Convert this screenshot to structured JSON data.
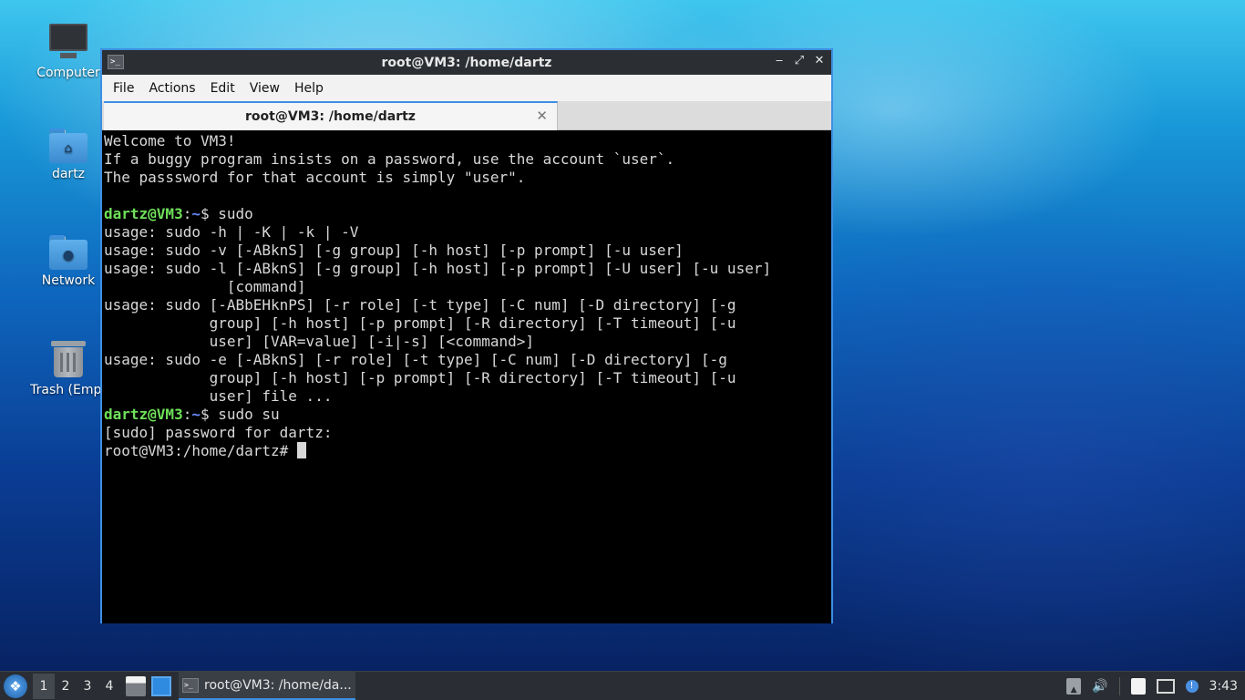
{
  "desktop": {
    "icons": [
      {
        "label": "Computer",
        "icon": "computer-icon"
      },
      {
        "label": "dartz",
        "icon": "home-folder-icon"
      },
      {
        "label": "Network",
        "icon": "network-folder-icon"
      },
      {
        "label": "Trash (Empt",
        "icon": "trash-icon"
      }
    ]
  },
  "window": {
    "title": "root@VM3: /home/dartz",
    "menu": [
      "File",
      "Actions",
      "Edit",
      "View",
      "Help"
    ],
    "tab_title": "root@VM3: /home/dartz",
    "controls": {
      "minimize": "‒",
      "maximize": "⤢",
      "close": "✕"
    }
  },
  "terminal": {
    "lines": [
      {
        "text": "Welcome to VM3!"
      },
      {
        "text": "If a buggy program insists on a password, use the account `user`."
      },
      {
        "text": "The passsword for that account is simply \"user\"."
      },
      {
        "text": ""
      },
      {
        "user": "dartz@VM3",
        "sep": ":",
        "path": "~",
        "text": "$ sudo"
      },
      {
        "text": "usage: sudo -h | -K | -k | -V"
      },
      {
        "text": "usage: sudo -v [-ABknS] [-g group] [-h host] [-p prompt] [-u user]"
      },
      {
        "text": "usage: sudo -l [-ABknS] [-g group] [-h host] [-p prompt] [-U user] [-u user]"
      },
      {
        "text": "              [command]"
      },
      {
        "text": "usage: sudo [-ABbEHknPS] [-r role] [-t type] [-C num] [-D directory] [-g"
      },
      {
        "text": "            group] [-h host] [-p prompt] [-R directory] [-T timeout] [-u"
      },
      {
        "text": "            user] [VAR=value] [-i|-s] [<command>]"
      },
      {
        "text": "usage: sudo -e [-ABknS] [-r role] [-t type] [-C num] [-D directory] [-g"
      },
      {
        "text": "            group] [-h host] [-p prompt] [-R directory] [-T timeout] [-u"
      },
      {
        "text": "            user] file ..."
      },
      {
        "user": "dartz@VM3",
        "sep": ":",
        "path": "~",
        "text": "$ sudo su"
      },
      {
        "text": "[sudo] password for dartz:"
      },
      {
        "text": "root@VM3:/home/dartz# "
      }
    ]
  },
  "taskbar": {
    "workspaces": [
      "1",
      "2",
      "3",
      "4"
    ],
    "active_workspace": "1",
    "task_label": "root@VM3: /home/da...",
    "clock": "3:43",
    "tray_icons": [
      "tray-up-icon",
      "volume-icon",
      "clipboard-icon",
      "display-icon",
      "notification-icon"
    ]
  }
}
